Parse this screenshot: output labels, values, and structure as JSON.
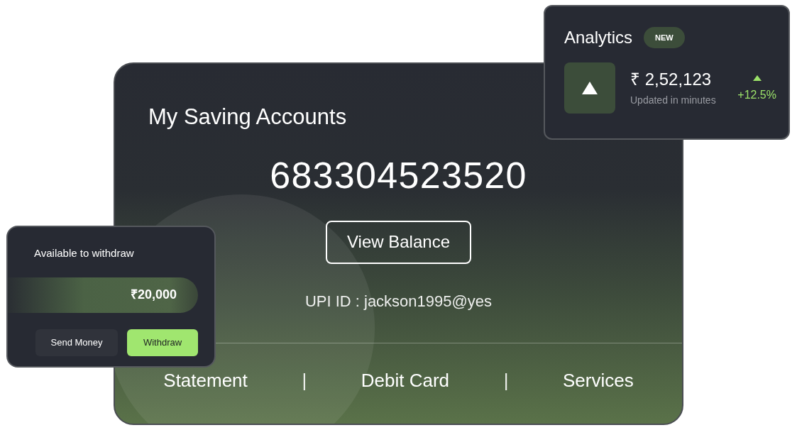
{
  "account_card": {
    "title": "My Saving Accounts",
    "account_number": "683304523520",
    "button": "View Balance",
    "upi": "UPI ID : jackson1995@yes",
    "footer": [
      {
        "kind": "link",
        "label": "Statement"
      },
      {
        "kind": "separator",
        "label": "|"
      },
      {
        "kind": "link",
        "label": "Debit Card"
      },
      {
        "kind": "separator",
        "label": "|"
      },
      {
        "kind": "link",
        "label": "Services"
      }
    ]
  },
  "analytics_card": {
    "title": "Analytics",
    "badge": "NEW",
    "amount": "₹ 2,52,123",
    "caption": "Updated in minutes",
    "change": "+12.5%"
  },
  "withdraw_card": {
    "title": "Available to withdraw",
    "amount": "₹20,000",
    "buttons": [
      {
        "label": "Send Money",
        "primary": false
      },
      {
        "label": "Withdraw",
        "primary": true
      }
    ]
  }
}
